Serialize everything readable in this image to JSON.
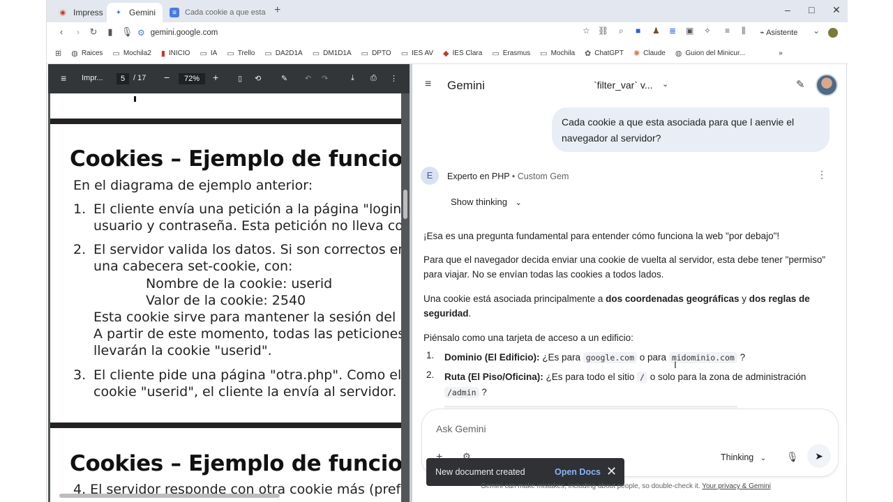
{
  "tabs": [
    {
      "title": "Impress",
      "favicon": "impress-icon"
    },
    {
      "title": "Gemini",
      "favicon": "gemini-icon"
    },
    {
      "title": "Cada cookie a que esta asoci",
      "favicon": "docs-icon"
    }
  ],
  "window_controls": {
    "minimize": "–",
    "maximize": "□",
    "close": "✕"
  },
  "address": {
    "url": "gemini.google.com"
  },
  "assistant_label": "Asistente",
  "bookmarks": [
    "Raices",
    "Mochila2",
    "INICIO",
    "IA",
    "Trello",
    "DA2D1A",
    "DM1D1A",
    "DPTO",
    "IES AV",
    "IES Clara",
    "Erasmus",
    "Mochila",
    "ChatGPT",
    "Claude",
    "Guion del Minicur..."
  ],
  "pdf": {
    "doc_title": "Impr...",
    "page": "5",
    "total_pages": "/ 17",
    "zoom": "72%",
    "slide1": {
      "title": "Cookies – Ejemplo de funciona",
      "intro": "En el diagrama de ejemplo anterior:",
      "items": [
        {
          "num": "1.",
          "lines": [
            "El cliente envía una petición a la página \"login.",
            "usuario y contraseña. Esta petición no lleva coo"
          ]
        },
        {
          "num": "2.",
          "lines": [
            "El servidor valida los datos. Si son correctos en",
            "una cabecera set-cookie, con:"
          ]
        },
        {
          "num": "3.",
          "lines": [
            "El cliente pide una página \"otra.php\". Como el",
            "cookie \"userid\", el cliente la envía al servidor."
          ]
        }
      ],
      "sub_lines": [
        "Nombre de la cookie: userid",
        "Valor de la cookie: 2540"
      ],
      "item2_extra": [
        "Esta cookie sirve para mantener la sesión del u",
        "A partir de este momento, todas las peticiones",
        "llevarán la cookie \"userid\"."
      ]
    },
    "slide2": {
      "title": "Cookies – Ejemplo de funciona",
      "first_line": "4.  El servidor responde con otra cookie más (pref"
    }
  },
  "gemini": {
    "app_title": "Gemini",
    "chat_title": "`filter_var` v...",
    "user_message": "Cada cookie a que esta asociada para que l aenvie el navegador al servidor?",
    "gem_initial": "E",
    "gem_name": "Experto en PHP",
    "gem_sub": "• Custom Gem",
    "show_thinking": "Show thinking",
    "p1": "¡Esa es una pregunta fundamental para entender cómo funciona la web \"por debajo\"!",
    "p2": "Para que el navegador decida enviar una cookie de vuelta al servidor, esta debe tener \"permiso\" para viajar. No se envían todas las cookies a todos lados.",
    "p3_a": "Una cookie está asociada principalmente a ",
    "p3_b": "dos coordenadas geográficas",
    "p3_c": " y ",
    "p3_d": "dos reglas de seguridad",
    "p3_e": ".",
    "p4": "Piénsalo como una tarjeta de acceso a un edificio:",
    "li1_num": "1.",
    "li1_bold": "Dominio (El Edificio):",
    "li1_a": " ¿Es para ",
    "li1_code1": "google.com",
    "li1_b": " o para ",
    "li1_code2": "midominio.com",
    "li1_c": " ?",
    "li2_num": "2.",
    "li2_bold": "Ruta (El Piso/Oficina):",
    "li2_a": " ¿Es para todo el sitio ",
    "li2_code1": "/",
    "li2_b": " o solo para la zona de administración",
    "li2_code2": "/admin",
    "li2_c": " ?",
    "input_placeholder": "Ask Gemini",
    "mode": "Thinking",
    "toast_message": "New document created",
    "toast_action": "Open Docs",
    "disclaimer": "Gemini can make mistakes, including about people, so double-check it.",
    "privacy_link": "Your privacy & Gemini"
  }
}
